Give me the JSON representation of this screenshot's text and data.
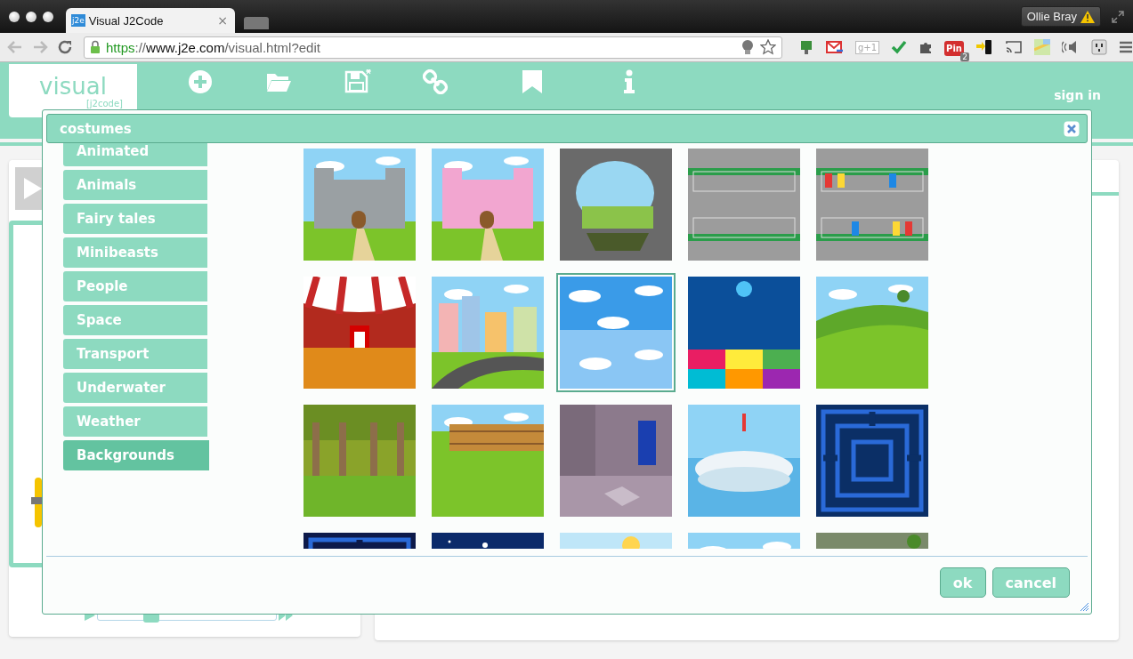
{
  "browser": {
    "tab": {
      "favicon": "j2e",
      "title": "Visual J2Code",
      "close": "×"
    },
    "profile": {
      "name": "Ollie Bray"
    },
    "url": {
      "scheme": "https",
      "separator": "://",
      "host": "www.j2e.com",
      "path": "/visual.html?edit"
    },
    "extensions": {
      "gplus": "g+1",
      "pin": "Pin",
      "pin_count": "2"
    }
  },
  "app": {
    "logo": {
      "title": "visual",
      "subtitle": "[j2code]"
    },
    "toolbar": [
      {
        "kind": "new"
      },
      {
        "kind": "load"
      },
      {
        "kind": "save"
      },
      {
        "kind": "link"
      },
      {
        "kind": "examples"
      },
      {
        "kind": "about"
      }
    ],
    "sign_in": "sign in",
    "speed_slider": {
      "level": 0.3
    }
  },
  "dialog": {
    "title": "costumes",
    "categories": [
      {
        "label": "Animated",
        "selected": false
      },
      {
        "label": "Animals",
        "selected": false
      },
      {
        "label": "Fairy tales",
        "selected": false
      },
      {
        "label": "Minibeasts",
        "selected": false
      },
      {
        "label": "People",
        "selected": false
      },
      {
        "label": "Space",
        "selected": false
      },
      {
        "label": "Transport",
        "selected": false
      },
      {
        "label": "Underwater",
        "selected": false
      },
      {
        "label": "Weather",
        "selected": false
      },
      {
        "label": "Backgrounds",
        "selected": true
      }
    ],
    "tiles": [
      {
        "kind": "picture",
        "selected": false
      },
      {
        "kind": "picture",
        "selected": false
      },
      {
        "kind": "picture",
        "selected": false
      },
      {
        "kind": "picture",
        "selected": false
      },
      {
        "kind": "picture",
        "selected": false
      },
      {
        "kind": "picture",
        "selected": false
      },
      {
        "kind": "picture",
        "selected": false
      },
      {
        "kind": "picture",
        "selected": true
      },
      {
        "kind": "picture",
        "selected": false
      },
      {
        "kind": "picture",
        "selected": false
      },
      {
        "kind": "picture",
        "selected": false
      },
      {
        "kind": "picture",
        "selected": false
      },
      {
        "kind": "picture",
        "selected": false
      },
      {
        "kind": "picture",
        "selected": false
      },
      {
        "kind": "picture",
        "selected": false
      },
      {
        "kind": "picture",
        "selected": false
      },
      {
        "kind": "picture",
        "selected": false
      },
      {
        "kind": "picture",
        "selected": false
      },
      {
        "kind": "picture",
        "selected": false
      },
      {
        "kind": "picture",
        "selected": false
      }
    ],
    "buttons": [
      "ok",
      "cancel"
    ]
  }
}
